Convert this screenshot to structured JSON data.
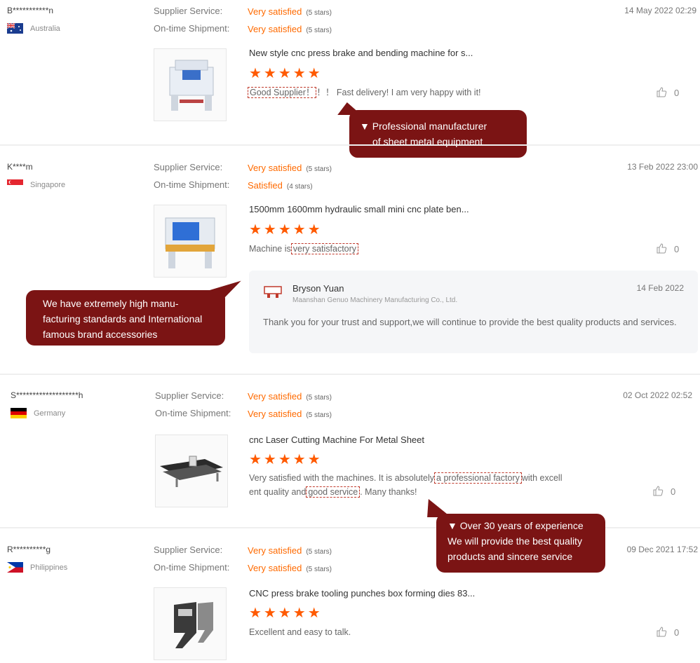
{
  "labels": {
    "supplier_service": "Supplier Service:",
    "ontime_shipment": "On-time Shipment:"
  },
  "reviews": [
    {
      "name": "B***********n",
      "country": "Australia",
      "supplier_value": "Very satisfied",
      "supplier_stars": "(5 stars)",
      "shipment_value": "Very satisfied",
      "shipment_stars": "(5 stars)",
      "date": "14 May 2022 02:29",
      "product_title": "New style cnc press brake and bending machine for s...",
      "rating": "★★★★★",
      "comment_parts": [
        "Good Supplier！",
        "！！ Fast delivery! I am very happy with it!"
      ],
      "likes": "0"
    },
    {
      "name": "K****m",
      "country": "Singapore",
      "supplier_value": "Very satisfied",
      "supplier_stars": "(5 stars)",
      "shipment_value": "Satisfied",
      "shipment_stars": "(4 stars)",
      "date": "13 Feb 2022 23:00",
      "product_title": "1500mm 1600mm hydraulic small mini cnc plate ben...",
      "rating": "★★★★★",
      "comment_parts": [
        "Machine is",
        "very satisfactory"
      ],
      "likes": "0",
      "reply": {
        "author": "Bryson Yuan",
        "company": "Maanshan Genuo Machinery Manufacturing Co., Ltd.",
        "date": "14 Feb 2022",
        "text": "Thank you for your trust and support,we will continue to provide the best quality products and services."
      }
    },
    {
      "name": "S*******************h",
      "country": "Germany",
      "supplier_value": "Very satisfied",
      "supplier_stars": "(5 stars)",
      "shipment_value": "Very satisfied",
      "shipment_stars": "(5 stars)",
      "date": "02 Oct 2022 02:52",
      "product_title": "cnc Laser Cutting Machine For Metal Sheet",
      "rating": "★★★★★",
      "comment_parts": [
        "Very satisfied with the machines. It is absolutely",
        "a professional factory",
        "with excell",
        "ent quality and",
        "good service",
        ". Many thanks!"
      ],
      "likes": "0"
    },
    {
      "name": "R**********g",
      "country": "Philippines",
      "supplier_value": "Very satisfied",
      "supplier_stars": "(5 stars)",
      "shipment_value": "Very satisfied",
      "shipment_stars": "(5 stars)",
      "date": "09 Dec 2021 17:52",
      "product_title": "CNC press brake tooling punches box forming dies 83...",
      "rating": "★★★★★",
      "comment_parts": [
        "Excellent and easy to talk."
      ],
      "likes": "0"
    }
  ],
  "callouts": {
    "one": [
      "▼ Professional manufacturer",
      "of sheet metal equipment"
    ],
    "two": [
      "We have extremely high manu-",
      "facturing standards and International",
      "famous brand accessories"
    ],
    "three": [
      "▼ Over 30 years of experience",
      "We will provide the best quality",
      "products and sincere service"
    ]
  },
  "colors": {
    "accent": "#ff6a00",
    "callout": "#7b1414",
    "highlight_border": "#c0392b"
  }
}
